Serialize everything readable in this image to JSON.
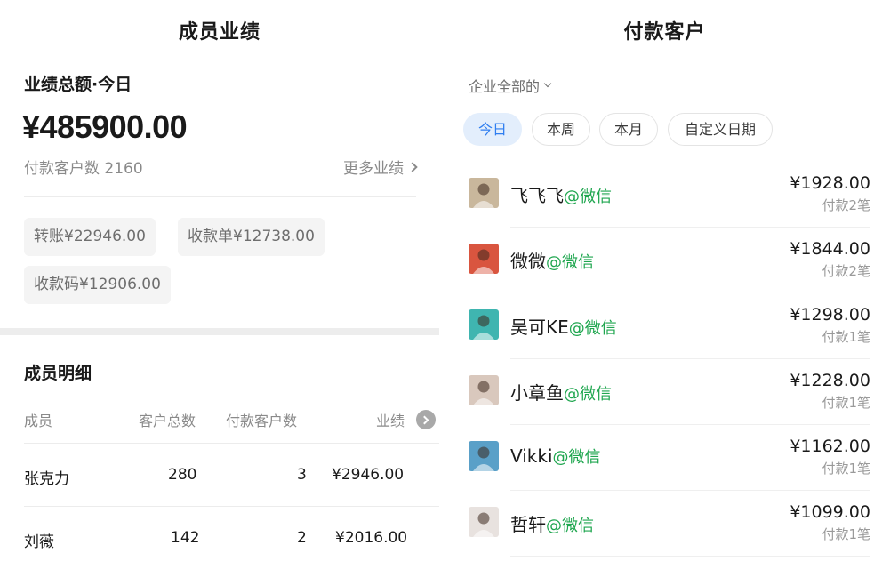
{
  "left": {
    "title": "成员业绩",
    "summary_label": "业绩总额·今日",
    "total_amount": "¥485900.00",
    "pay_count": "付款客户数 2160",
    "more_link": "更多业绩",
    "chips": [
      "转账¥22946.00",
      "收款单¥12738.00",
      "收款码¥12906.00"
    ],
    "detail_title": "成员明细",
    "columns": [
      "成员",
      "客户总数",
      "付款客户数",
      "业绩"
    ],
    "rows": [
      {
        "name": "张克力",
        "total": "280",
        "paid": "3",
        "amount": "¥2946.00"
      },
      {
        "name": "刘薇",
        "total": "142",
        "paid": "2",
        "amount": "¥2016.00"
      }
    ]
  },
  "right": {
    "title": "付款客户",
    "scope": "企业全部的",
    "tabs": [
      "今日",
      "本周",
      "本月",
      "自定义日期"
    ],
    "active_tab": "今日",
    "customers": [
      {
        "name": "飞飞飞",
        "source": "@微信",
        "amount": "¥1928.00",
        "count": "付款2笔",
        "avatar_color": "#c9b79c"
      },
      {
        "name": "微微",
        "source": "@微信",
        "amount": "¥1844.00",
        "count": "付款2笔",
        "avatar_color": "#d9553f"
      },
      {
        "name": "吴可KE",
        "source": "@微信",
        "amount": "¥1298.00",
        "count": "付款1笔",
        "avatar_color": "#3fb5b0"
      },
      {
        "name": "小章鱼",
        "source": "@微信",
        "amount": "¥1228.00",
        "count": "付款1笔",
        "avatar_color": "#d9c8bd"
      },
      {
        "name": "Vikki",
        "source": "@微信",
        "amount": "¥1162.00",
        "count": "付款1笔",
        "avatar_color": "#5aa0c8"
      },
      {
        "name": "哲轩",
        "source": "@微信",
        "amount": "¥1099.00",
        "count": "付款1笔",
        "avatar_color": "#e8e2df"
      }
    ]
  },
  "colors": {
    "accent_blue": "#2f7ef0",
    "source_green": "#1fa64f"
  }
}
